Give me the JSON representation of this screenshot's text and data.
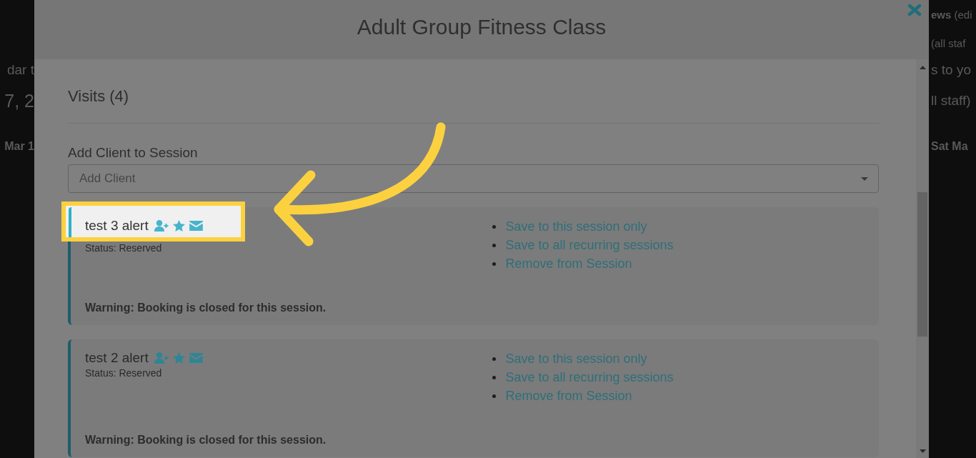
{
  "background_page": {
    "rows": [
      {
        "right": {
          "text": "**ews** (edi",
          "kind": "small"
        }
      },
      {
        "right": {
          "text": "(all staf",
          "kind": "small"
        }
      },
      {
        "left": {
          "text": "dar t",
          "kind": "medium"
        },
        "right": {
          "text": "s to yo",
          "kind": "medium"
        }
      },
      {
        "left": {
          "text": "7, 2",
          "kind": "large"
        },
        "right": {
          "text": "ll staff)",
          "kind": "medium"
        }
      },
      {
        "left": {
          "text": "Mar 1",
          "kind": "bold"
        },
        "right": {
          "text": "Sat Ma",
          "kind": "bold"
        }
      }
    ]
  },
  "modal": {
    "title": "Adult Group Fitness Class"
  },
  "visits": {
    "heading": "Visits (4)"
  },
  "add_client": {
    "label": "Add Client to Session",
    "placeholder": "Add Client"
  },
  "clients": [
    {
      "name": "test 3 alert",
      "status": "Status: Reserved",
      "highlighted": true,
      "actions": [
        "Save to this session only",
        "Save to all recurring sessions",
        "Remove from Session"
      ],
      "warning": "Warning: Booking is closed for this session."
    },
    {
      "name": "test 2 alert",
      "status": "Status: Reserved",
      "highlighted": false,
      "actions": [
        "Save to this session only",
        "Save to all recurring sessions",
        "Remove from Session"
      ],
      "warning": "Warning: Booking is closed for this session."
    }
  ]
}
